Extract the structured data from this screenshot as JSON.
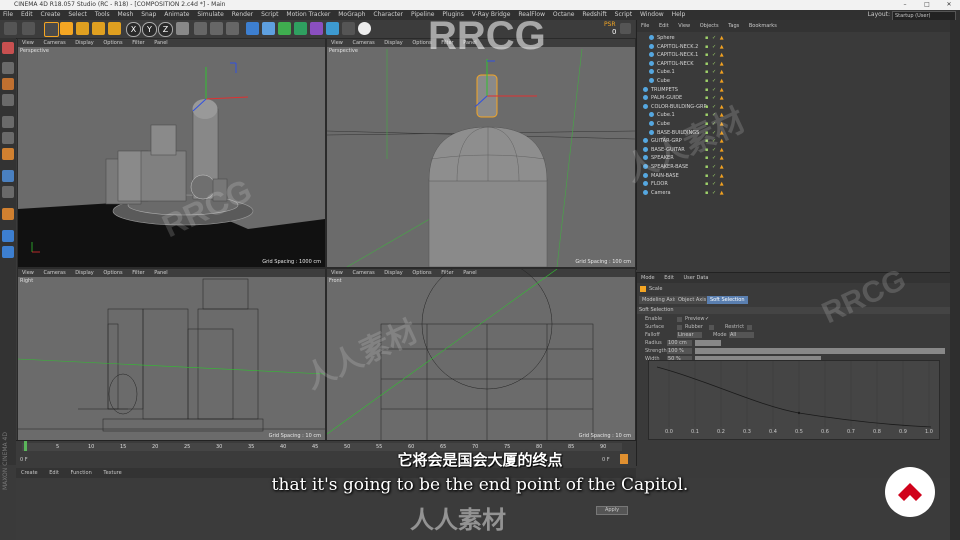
{
  "window": {
    "title": "CINEMA 4D R18.057 Studio (RC - R18) - [COMPOSITION 2.c4d *] - Main",
    "controls": [
      "–",
      "□",
      "✕"
    ]
  },
  "menubar": [
    "File",
    "Edit",
    "Create",
    "Select",
    "Tools",
    "Mesh",
    "Snap",
    "Animate",
    "Simulate",
    "Render",
    "Script",
    "Motion Tracker",
    "MoGraph",
    "Character",
    "Pipeline",
    "Plugins",
    "V-Ray Bridge",
    "RealFlow",
    "Octane",
    "Redshift",
    "Script",
    "Window",
    "Help"
  ],
  "layout": {
    "label": "Layout:",
    "value": "Startup (User)"
  },
  "toolbar": {
    "axis_labels": [
      "X",
      "Y",
      "Z"
    ],
    "psr_label": "PSR",
    "psr_value": "0"
  },
  "viewport_menu": [
    "View",
    "Cameras",
    "Display",
    "Options",
    "Filter",
    "Panel"
  ],
  "viewports": [
    {
      "label": "Perspective",
      "grid": "Grid Spacing : 1000 cm"
    },
    {
      "label": "Perspective",
      "grid": "Grid Spacing : 100 cm"
    },
    {
      "label": "Right",
      "grid": "Grid Spacing : 10 cm"
    },
    {
      "label": "Front",
      "grid": "Grid Spacing : 10 cm"
    }
  ],
  "object_manager": {
    "menu": [
      "File",
      "Edit",
      "View",
      "Objects",
      "Tags",
      "Bookmarks"
    ],
    "objects": [
      {
        "name": "Sphere",
        "indent": 1
      },
      {
        "name": "CAPITOL-NECK.2",
        "indent": 1
      },
      {
        "name": "CAPITOL-NECK.1",
        "indent": 1
      },
      {
        "name": "CAPITOL-NECK",
        "indent": 1
      },
      {
        "name": "Cube.1",
        "indent": 1
      },
      {
        "name": "Cube",
        "indent": 1
      },
      {
        "name": "TRUMPETS",
        "indent": 0
      },
      {
        "name": "PALM-GUIDE",
        "indent": 0
      },
      {
        "name": "COLOR-BUILDING-GRP",
        "indent": 0
      },
      {
        "name": "Cube.1",
        "indent": 1
      },
      {
        "name": "Cube",
        "indent": 1
      },
      {
        "name": "BASE-BUILDINGS",
        "indent": 1
      },
      {
        "name": "GUITAR-GRP",
        "indent": 0
      },
      {
        "name": "BASE-GUITAR",
        "indent": 0
      },
      {
        "name": "SPEAKER",
        "indent": 0
      },
      {
        "name": "SPEAKER-BASE",
        "indent": 0
      },
      {
        "name": "MAIN-BASE",
        "indent": 0
      },
      {
        "name": "FLOOR",
        "indent": 0
      },
      {
        "name": "Camera",
        "indent": 0
      }
    ]
  },
  "attribute_manager": {
    "menu": [
      "Mode",
      "Edit",
      "User Data"
    ],
    "object": "Scale",
    "tabs": [
      "Modeling Axis",
      "Object Axis",
      "Soft Selection"
    ],
    "section": "Soft Selection",
    "fields": [
      {
        "label": "Enable",
        "value": ""
      },
      {
        "label": "Preview",
        "value": "✓"
      },
      {
        "label": "Surface",
        "value": ""
      },
      {
        "label": "Rubber",
        "value": ""
      },
      {
        "label": "Restrict",
        "value": ""
      },
      {
        "label": "Falloff",
        "value": "Linear"
      },
      {
        "label": "Mode",
        "value": "All"
      },
      {
        "label": "Radius",
        "value": "100 cm"
      },
      {
        "label": "Strength",
        "value": "100 %"
      },
      {
        "label": "Width",
        "value": "50 %"
      }
    ],
    "curve_ticks": [
      "0.0",
      "0.1",
      "0.2",
      "0.3",
      "0.4",
      "0.5",
      "0.6",
      "0.7",
      "0.8",
      "0.9",
      "1.0"
    ]
  },
  "timeline": {
    "ticks": [
      "0",
      "5",
      "10",
      "15",
      "20",
      "25",
      "30",
      "35",
      "40",
      "45",
      "50",
      "55",
      "60",
      "65",
      "70",
      "75",
      "80",
      "85",
      "90"
    ],
    "frame_start": "0 F",
    "frame_end": "0 F"
  },
  "material_menu": [
    "Create",
    "Edit",
    "Function",
    "Texture"
  ],
  "coordinates": {
    "apply_label": "Apply"
  },
  "subtitles": {
    "cn": "它将会是国会大厦的终点",
    "en": "that it's going to be the end point of the Capitol."
  },
  "branding": {
    "maxon": "MAXON CINEMA 4D",
    "watermark": "RRCG",
    "watermark_cn": "人人素材"
  },
  "colors": {
    "accent": "#f5a623",
    "selection_blue": "#4a90d9",
    "logo_red": "#d0021b"
  }
}
